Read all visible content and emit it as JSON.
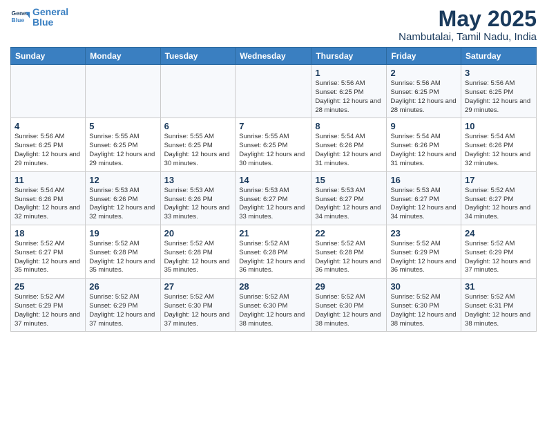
{
  "logo": {
    "line1": "General",
    "line2": "Blue"
  },
  "title": "May 2025",
  "location": "Nambutalai, Tamil Nadu, India",
  "weekdays": [
    "Sunday",
    "Monday",
    "Tuesday",
    "Wednesday",
    "Thursday",
    "Friday",
    "Saturday"
  ],
  "weeks": [
    [
      {
        "day": "",
        "info": ""
      },
      {
        "day": "",
        "info": ""
      },
      {
        "day": "",
        "info": ""
      },
      {
        "day": "",
        "info": ""
      },
      {
        "day": "1",
        "info": "Sunrise: 5:56 AM\nSunset: 6:25 PM\nDaylight: 12 hours\nand 28 minutes."
      },
      {
        "day": "2",
        "info": "Sunrise: 5:56 AM\nSunset: 6:25 PM\nDaylight: 12 hours\nand 28 minutes."
      },
      {
        "day": "3",
        "info": "Sunrise: 5:56 AM\nSunset: 6:25 PM\nDaylight: 12 hours\nand 29 minutes."
      }
    ],
    [
      {
        "day": "4",
        "info": "Sunrise: 5:56 AM\nSunset: 6:25 PM\nDaylight: 12 hours\nand 29 minutes."
      },
      {
        "day": "5",
        "info": "Sunrise: 5:55 AM\nSunset: 6:25 PM\nDaylight: 12 hours\nand 29 minutes."
      },
      {
        "day": "6",
        "info": "Sunrise: 5:55 AM\nSunset: 6:25 PM\nDaylight: 12 hours\nand 30 minutes."
      },
      {
        "day": "7",
        "info": "Sunrise: 5:55 AM\nSunset: 6:25 PM\nDaylight: 12 hours\nand 30 minutes."
      },
      {
        "day": "8",
        "info": "Sunrise: 5:54 AM\nSunset: 6:26 PM\nDaylight: 12 hours\nand 31 minutes."
      },
      {
        "day": "9",
        "info": "Sunrise: 5:54 AM\nSunset: 6:26 PM\nDaylight: 12 hours\nand 31 minutes."
      },
      {
        "day": "10",
        "info": "Sunrise: 5:54 AM\nSunset: 6:26 PM\nDaylight: 12 hours\nand 32 minutes."
      }
    ],
    [
      {
        "day": "11",
        "info": "Sunrise: 5:54 AM\nSunset: 6:26 PM\nDaylight: 12 hours\nand 32 minutes."
      },
      {
        "day": "12",
        "info": "Sunrise: 5:53 AM\nSunset: 6:26 PM\nDaylight: 12 hours\nand 32 minutes."
      },
      {
        "day": "13",
        "info": "Sunrise: 5:53 AM\nSunset: 6:26 PM\nDaylight: 12 hours\nand 33 minutes."
      },
      {
        "day": "14",
        "info": "Sunrise: 5:53 AM\nSunset: 6:27 PM\nDaylight: 12 hours\nand 33 minutes."
      },
      {
        "day": "15",
        "info": "Sunrise: 5:53 AM\nSunset: 6:27 PM\nDaylight: 12 hours\nand 34 minutes."
      },
      {
        "day": "16",
        "info": "Sunrise: 5:53 AM\nSunset: 6:27 PM\nDaylight: 12 hours\nand 34 minutes."
      },
      {
        "day": "17",
        "info": "Sunrise: 5:52 AM\nSunset: 6:27 PM\nDaylight: 12 hours\nand 34 minutes."
      }
    ],
    [
      {
        "day": "18",
        "info": "Sunrise: 5:52 AM\nSunset: 6:27 PM\nDaylight: 12 hours\nand 35 minutes."
      },
      {
        "day": "19",
        "info": "Sunrise: 5:52 AM\nSunset: 6:28 PM\nDaylight: 12 hours\nand 35 minutes."
      },
      {
        "day": "20",
        "info": "Sunrise: 5:52 AM\nSunset: 6:28 PM\nDaylight: 12 hours\nand 35 minutes."
      },
      {
        "day": "21",
        "info": "Sunrise: 5:52 AM\nSunset: 6:28 PM\nDaylight: 12 hours\nand 36 minutes."
      },
      {
        "day": "22",
        "info": "Sunrise: 5:52 AM\nSunset: 6:28 PM\nDaylight: 12 hours\nand 36 minutes."
      },
      {
        "day": "23",
        "info": "Sunrise: 5:52 AM\nSunset: 6:29 PM\nDaylight: 12 hours\nand 36 minutes."
      },
      {
        "day": "24",
        "info": "Sunrise: 5:52 AM\nSunset: 6:29 PM\nDaylight: 12 hours\nand 37 minutes."
      }
    ],
    [
      {
        "day": "25",
        "info": "Sunrise: 5:52 AM\nSunset: 6:29 PM\nDaylight: 12 hours\nand 37 minutes."
      },
      {
        "day": "26",
        "info": "Sunrise: 5:52 AM\nSunset: 6:29 PM\nDaylight: 12 hours\nand 37 minutes."
      },
      {
        "day": "27",
        "info": "Sunrise: 5:52 AM\nSunset: 6:30 PM\nDaylight: 12 hours\nand 37 minutes."
      },
      {
        "day": "28",
        "info": "Sunrise: 5:52 AM\nSunset: 6:30 PM\nDaylight: 12 hours\nand 38 minutes."
      },
      {
        "day": "29",
        "info": "Sunrise: 5:52 AM\nSunset: 6:30 PM\nDaylight: 12 hours\nand 38 minutes."
      },
      {
        "day": "30",
        "info": "Sunrise: 5:52 AM\nSunset: 6:30 PM\nDaylight: 12 hours\nand 38 minutes."
      },
      {
        "day": "31",
        "info": "Sunrise: 5:52 AM\nSunset: 6:31 PM\nDaylight: 12 hours\nand 38 minutes."
      }
    ]
  ]
}
